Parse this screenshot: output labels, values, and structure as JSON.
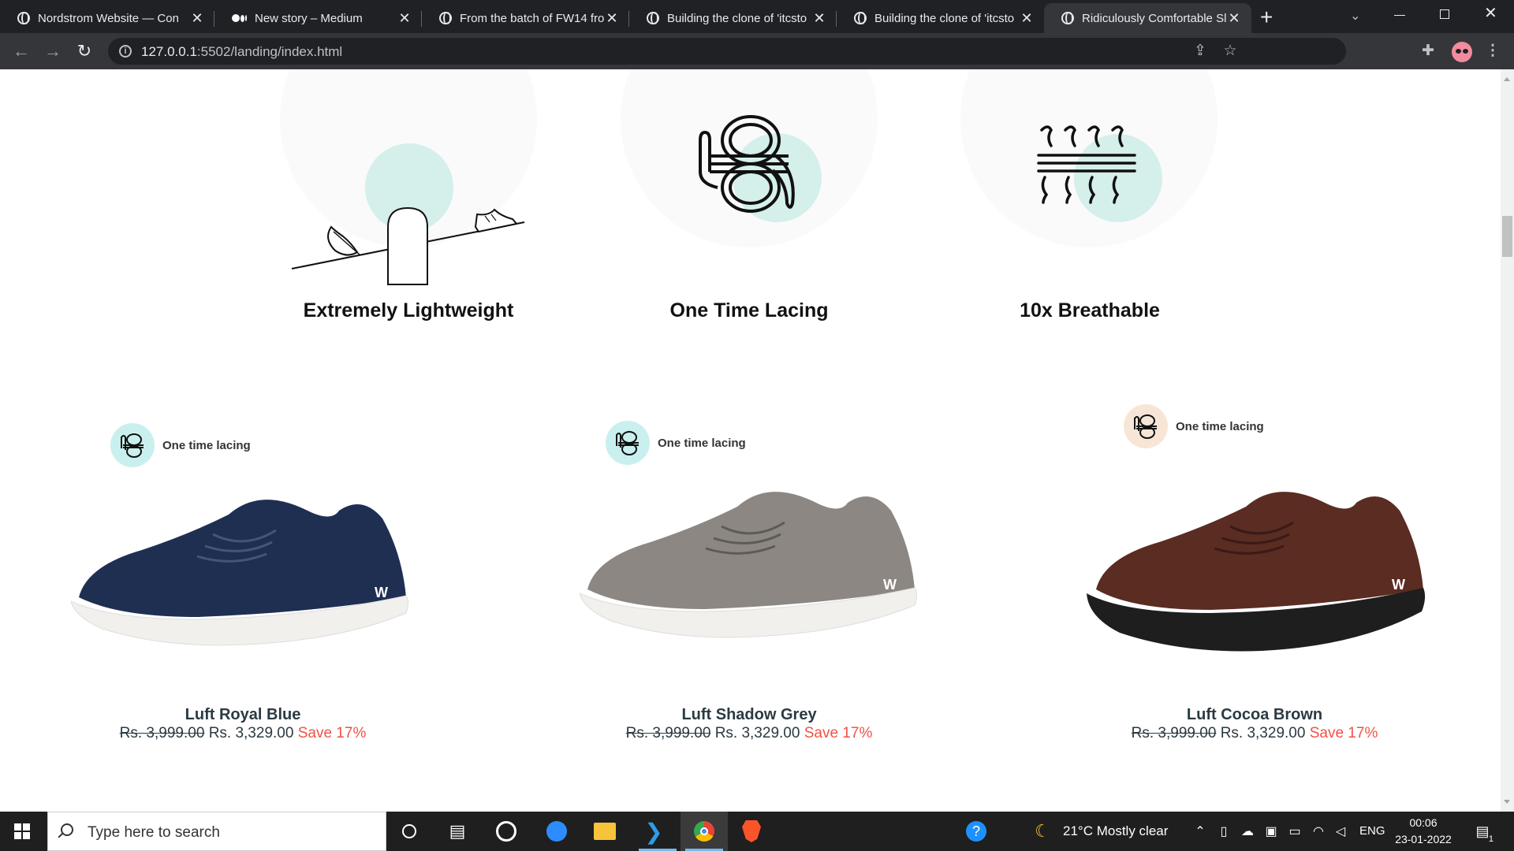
{
  "browser": {
    "tabs": [
      {
        "title": "Nordstrom Website — Con",
        "icon": "globe-icon",
        "active": false
      },
      {
        "title": "New story – Medium",
        "icon": "medium-icon",
        "active": false
      },
      {
        "title": "From the batch of FW14 fro",
        "icon": "globe-icon",
        "active": false
      },
      {
        "title": "Building the clone of 'itcsto",
        "icon": "globe-icon",
        "active": false
      },
      {
        "title": "Building the clone of 'itcsto",
        "icon": "globe-icon",
        "active": false
      },
      {
        "title": "Ridiculously Comfortable Sl",
        "icon": "globe-icon",
        "active": true
      }
    ],
    "url_host": "127.0.0.1",
    "url_rest": ":5502/landing/index.html",
    "new_tab_label": "+"
  },
  "features": [
    {
      "title": "Extremely Lightweight",
      "icon": "seesaw-feather-icon"
    },
    {
      "title": "One Time Lacing",
      "icon": "knot-icon"
    },
    {
      "title": "10x Breathable",
      "icon": "breathable-mesh-icon"
    }
  ],
  "products": [
    {
      "badge": "One time lacing",
      "name": "Luft Royal Blue",
      "old_price": "Rs. 3,999.00",
      "price": "Rs. 3,329.00",
      "save": "Save 17%",
      "badge_color": "#c9f0ee",
      "upper_color": "#1f2f52",
      "sole_color": "#f2f0ec"
    },
    {
      "badge": "One time lacing",
      "name": "Luft Shadow Grey",
      "old_price": "Rs. 3,999.00",
      "price": "Rs. 3,329.00",
      "save": "Save 17%",
      "badge_color": "#c9f0ee",
      "upper_color": "#8c8782",
      "sole_color": "#f2f0ec"
    },
    {
      "badge": "One time lacing",
      "name": "Luft Cocoa Brown",
      "old_price": "Rs. 3,999.00",
      "price": "Rs. 3,329.00",
      "save": "Save 17%",
      "badge_color": "#f7e6d6",
      "upper_color": "#5a2c22",
      "sole_color": "#1e1e1e"
    }
  ],
  "taskbar": {
    "search_placeholder": "Type here to search",
    "weather": "21°C  Mostly clear",
    "language": "ENG",
    "time": "00:06",
    "date": "23-01-2022",
    "notification_count": "1"
  }
}
